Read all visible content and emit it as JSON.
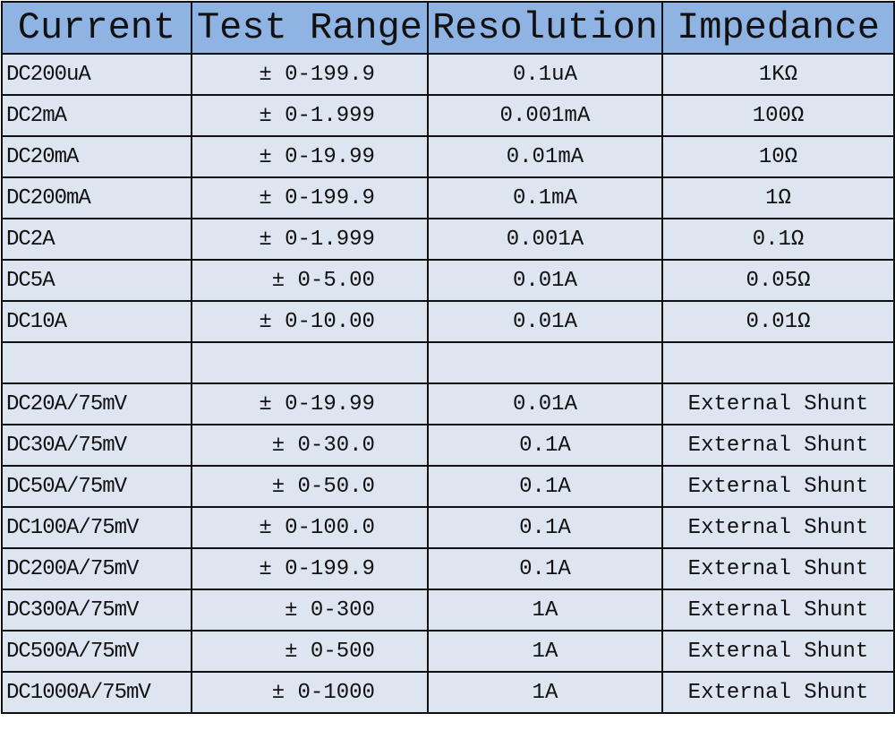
{
  "headers": [
    "Current",
    "Test Range",
    "Resolution",
    "Impedance"
  ],
  "rows": [
    [
      "DC200uA",
      "± 0-199.9",
      "0.1uA",
      "1KΩ"
    ],
    [
      "DC2mA",
      "± 0-1.999",
      "0.001mA",
      "100Ω"
    ],
    [
      "DC20mA",
      "± 0-19.99",
      "0.01mA",
      "10Ω"
    ],
    [
      "DC200mA",
      "± 0-199.9",
      "0.1mA",
      "1Ω"
    ],
    [
      "DC2A",
      "± 0-1.999",
      "0.001A",
      "0.1Ω"
    ],
    [
      "DC5A",
      "± 0-5.00",
      "0.01A",
      "0.05Ω"
    ],
    [
      "DC10A",
      "± 0-10.00",
      "0.01A",
      "0.01Ω"
    ],
    [
      "",
      "",
      "",
      ""
    ],
    [
      "DC20A/75mV",
      "± 0-19.99",
      "0.01A",
      "External Shunt"
    ],
    [
      "DC30A/75mV",
      "± 0-30.0",
      "0.1A",
      "External Shunt"
    ],
    [
      "DC50A/75mV",
      "± 0-50.0",
      "0.1A",
      "External Shunt"
    ],
    [
      "DC100A/75mV",
      "± 0-100.0",
      "0.1A",
      "External Shunt"
    ],
    [
      "DC200A/75mV",
      "± 0-199.9",
      "0.1A",
      "External Shunt"
    ],
    [
      "DC300A/75mV",
      "± 0-300",
      "1A",
      "External Shunt"
    ],
    [
      "DC500A/75mV",
      "± 0-500",
      "1A",
      "External Shunt"
    ],
    [
      "DC1000A/75mV",
      "± 0-1000",
      "1A",
      "External Shunt"
    ]
  ],
  "colors": {
    "header_bg": "#8fb3e2",
    "row_bg": "#dde5f1",
    "border": "#111111"
  }
}
